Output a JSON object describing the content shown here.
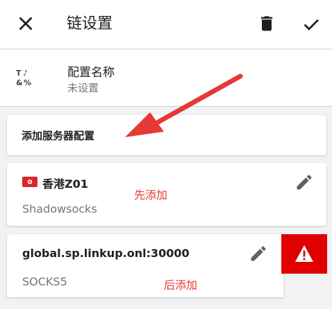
{
  "appbar": {
    "title": "链设置",
    "icons": [
      "close-icon",
      "delete-icon",
      "check-icon"
    ]
  },
  "name_row": {
    "label": "配置名称",
    "value": "未设置",
    "icon": "text-format-icon"
  },
  "add_card": {
    "label": "添加服务器配置"
  },
  "servers": [
    {
      "flag": "hong-kong-flag-icon",
      "name": "香港Z01",
      "type": "Shadowsocks",
      "note": "先添加"
    },
    {
      "name": "global.sp.linkup.onl:30000",
      "type": "SOCKS5",
      "note": "后添加"
    }
  ],
  "colors": {
    "annotation_red": "#e53935",
    "warning_bg": "#e00000",
    "arrow": "#e53935"
  }
}
